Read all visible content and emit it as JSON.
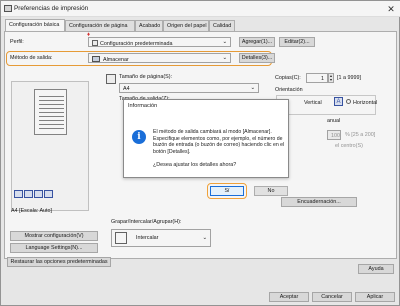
{
  "window": {
    "title": "Preferencias de impresión"
  },
  "tabs": [
    "Configuración básica",
    "Configuración de página",
    "Acabado",
    "Origen del papel",
    "Calidad"
  ],
  "profile": {
    "label": "Perfil:",
    "value": "Configuración predeterminada",
    "add": "Agregar(1)...",
    "edit": "Editar(2)..."
  },
  "output": {
    "label": "Método de salida:",
    "value": "Almacenar",
    "details": "Detalles(3)..."
  },
  "page_size": {
    "label": "Tamaño de página(S):",
    "value": "A4"
  },
  "output_size": {
    "label": "Tamaño de salida(Z):"
  },
  "copies": {
    "label": "Copias(C):",
    "value": "1",
    "range": "[1 a 9999]"
  },
  "orientation": {
    "label": "Orientación",
    "vertical": "Vertical",
    "horizontal": "Horizontal"
  },
  "manual": {
    "label": "anual",
    "scale": "100",
    "scale_range": "% [25 a 200]",
    "cut": "el centro(S)"
  },
  "preview": {
    "caption": "A4 [Escala: Auto]"
  },
  "binding": {
    "label": "Encuadernación..."
  },
  "group": {
    "label": "Grapar/Intercalar/Agrupar(H):",
    "value": "Intercalar"
  },
  "left_buttons": {
    "show_settings": "Mostrar configuración(V)",
    "language": "Language Settings(N)...",
    "restore": "Restaurar las opciones predeterminadas"
  },
  "footer": {
    "accept": "Aceptar",
    "cancel": "Cancelar",
    "apply": "Aplicar",
    "help": "Ayuda"
  },
  "dialog": {
    "title": "Información",
    "message": "El método de salida cambiará al modo [Almacenar]. Especifique elementos como, por ejemplo, el número de buzón de entrada (o buzón de correo) haciendo clic en el botón [Detalles].",
    "question": "¿Desea ajustar los detalles ahora?",
    "yes": "Sí",
    "no": "No"
  },
  "colors": {
    "highlight": "#f0a23a",
    "info": "#1a6ed8"
  }
}
